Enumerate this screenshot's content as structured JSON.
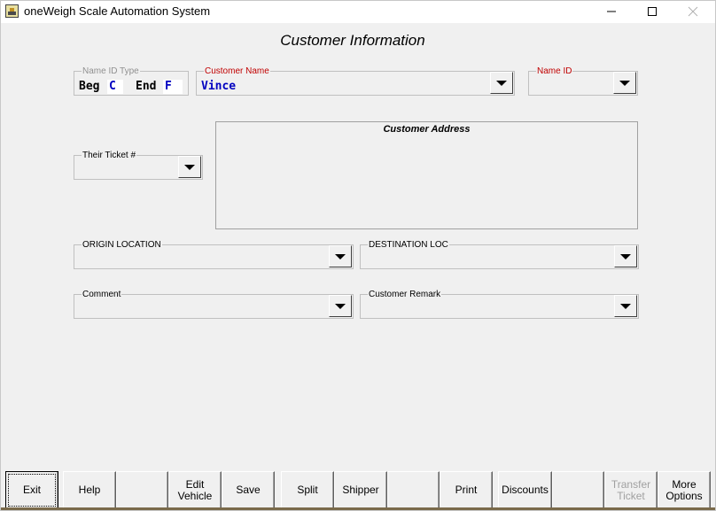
{
  "window": {
    "title": "oneWeigh Scale Automation System",
    "controls": {
      "minimize": "minimize-icon",
      "maximize": "maximize-icon",
      "close": "close-icon"
    }
  },
  "screen": {
    "title": "Customer Information"
  },
  "name_id_type": {
    "legend": "Name ID Type",
    "beg_label": "Beg",
    "beg_value": "C",
    "end_label": "End",
    "end_value": "F"
  },
  "customer_name": {
    "legend": "Customer Name",
    "value": "Vince"
  },
  "name_id": {
    "legend": "Name ID",
    "value": ""
  },
  "their_ticket": {
    "legend": "Their Ticket #",
    "value": ""
  },
  "customer_address": {
    "title": "Customer Address"
  },
  "origin_location": {
    "legend": "ORIGIN LOCATION",
    "value": ""
  },
  "destination_loc": {
    "legend": "DESTINATION LOC",
    "value": ""
  },
  "comment": {
    "legend": "Comment",
    "value": ""
  },
  "customer_remark": {
    "legend": "Customer Remark",
    "value": ""
  },
  "toolbar": {
    "buttons": [
      {
        "label": "Exit",
        "enabled": true
      },
      {
        "label": "Help",
        "enabled": true
      },
      {
        "label": "",
        "enabled": true
      },
      {
        "label": "Edit\nVehicle",
        "enabled": true
      },
      {
        "label": "Save",
        "enabled": true
      },
      {
        "label": "Split",
        "enabled": true
      },
      {
        "label": "Shipper",
        "enabled": true
      },
      {
        "label": "",
        "enabled": true
      },
      {
        "label": "Print",
        "enabled": true
      },
      {
        "label": "Discounts",
        "enabled": true
      },
      {
        "label": "",
        "enabled": true
      },
      {
        "label": "Transfer\nTicket",
        "enabled": false
      },
      {
        "label": "More\nOptions",
        "enabled": true
      }
    ]
  },
  "colors": {
    "accent_blue": "#0000c0",
    "legend_red": "#c00000",
    "disabled_gray": "#a0a0a0"
  }
}
